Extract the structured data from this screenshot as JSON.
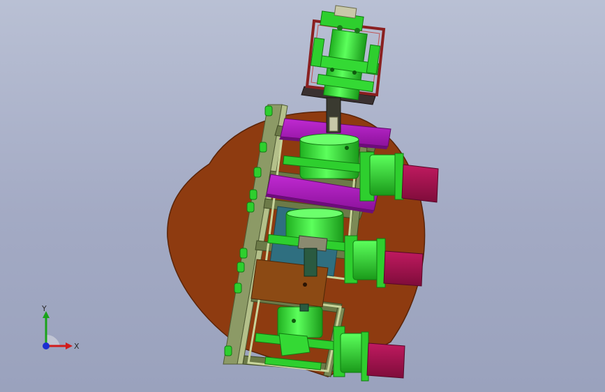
{
  "triad": {
    "x_label": "X",
    "y_label": "Y",
    "x_color": "#d11c1c",
    "y_color": "#1aa31a",
    "z_color": "#1c2fd1"
  },
  "colors": {
    "background_top": "#b9c0d4",
    "background_bottom": "#9aa2bd",
    "disc": "#8e3b10",
    "frame": "#7a8a5a",
    "green_parts": "#33ee33",
    "magenta_plates": "#a718b8",
    "motors": "#a0134e",
    "bronze_block": "#8c4a14",
    "teal_window": "#2f6f80",
    "top_frame": "#8a2020"
  }
}
